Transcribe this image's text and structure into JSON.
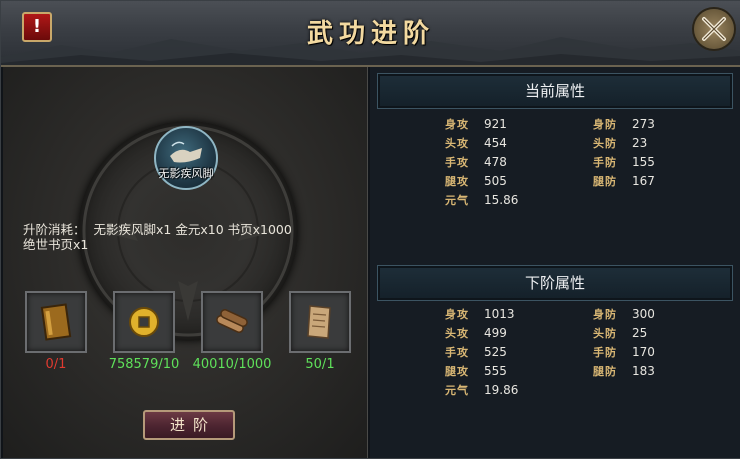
{
  "window": {
    "title": "武功进阶",
    "alert_icon": "!",
    "colors": {
      "title": "#f3d9a0",
      "stat_label": "#d9b774",
      "count_ok": "#5fe05a",
      "count_lack": "#e03a30"
    }
  },
  "skill": {
    "name": "无影疾风脚",
    "cost_label": "升阶消耗：",
    "cost_line1": "无影疾风脚x1 金元x10 书页x1000",
    "cost_line2": "绝世书页x1"
  },
  "materials": [
    {
      "icon": "book-icon",
      "count": "0/1",
      "sufficient": false
    },
    {
      "icon": "coin-icon",
      "count": "758579/10",
      "sufficient": true
    },
    {
      "icon": "scroll-bundle-icon",
      "count": "40010/1000",
      "sufficient": true
    },
    {
      "icon": "parchment-icon",
      "count": "50/1",
      "sufficient": true
    }
  ],
  "advance_button": "进阶",
  "current": {
    "title": "当前属性",
    "left": [
      {
        "label": "身攻",
        "value": "921"
      },
      {
        "label": "头攻",
        "value": "454"
      },
      {
        "label": "手攻",
        "value": "478"
      },
      {
        "label": "腿攻",
        "value": "505"
      },
      {
        "label": "元气",
        "value": "15.86"
      }
    ],
    "right": [
      {
        "label": "身防",
        "value": "273"
      },
      {
        "label": "头防",
        "value": "23"
      },
      {
        "label": "手防",
        "value": "155"
      },
      {
        "label": "腿防",
        "value": "167"
      }
    ]
  },
  "next": {
    "title": "下阶属性",
    "left": [
      {
        "label": "身攻",
        "value": "1013"
      },
      {
        "label": "头攻",
        "value": "499"
      },
      {
        "label": "手攻",
        "value": "525"
      },
      {
        "label": "腿攻",
        "value": "555"
      },
      {
        "label": "元气",
        "value": "19.86"
      }
    ],
    "right": [
      {
        "label": "身防",
        "value": "300"
      },
      {
        "label": "头防",
        "value": "25"
      },
      {
        "label": "手防",
        "value": "170"
      },
      {
        "label": "腿防",
        "value": "183"
      }
    ]
  }
}
